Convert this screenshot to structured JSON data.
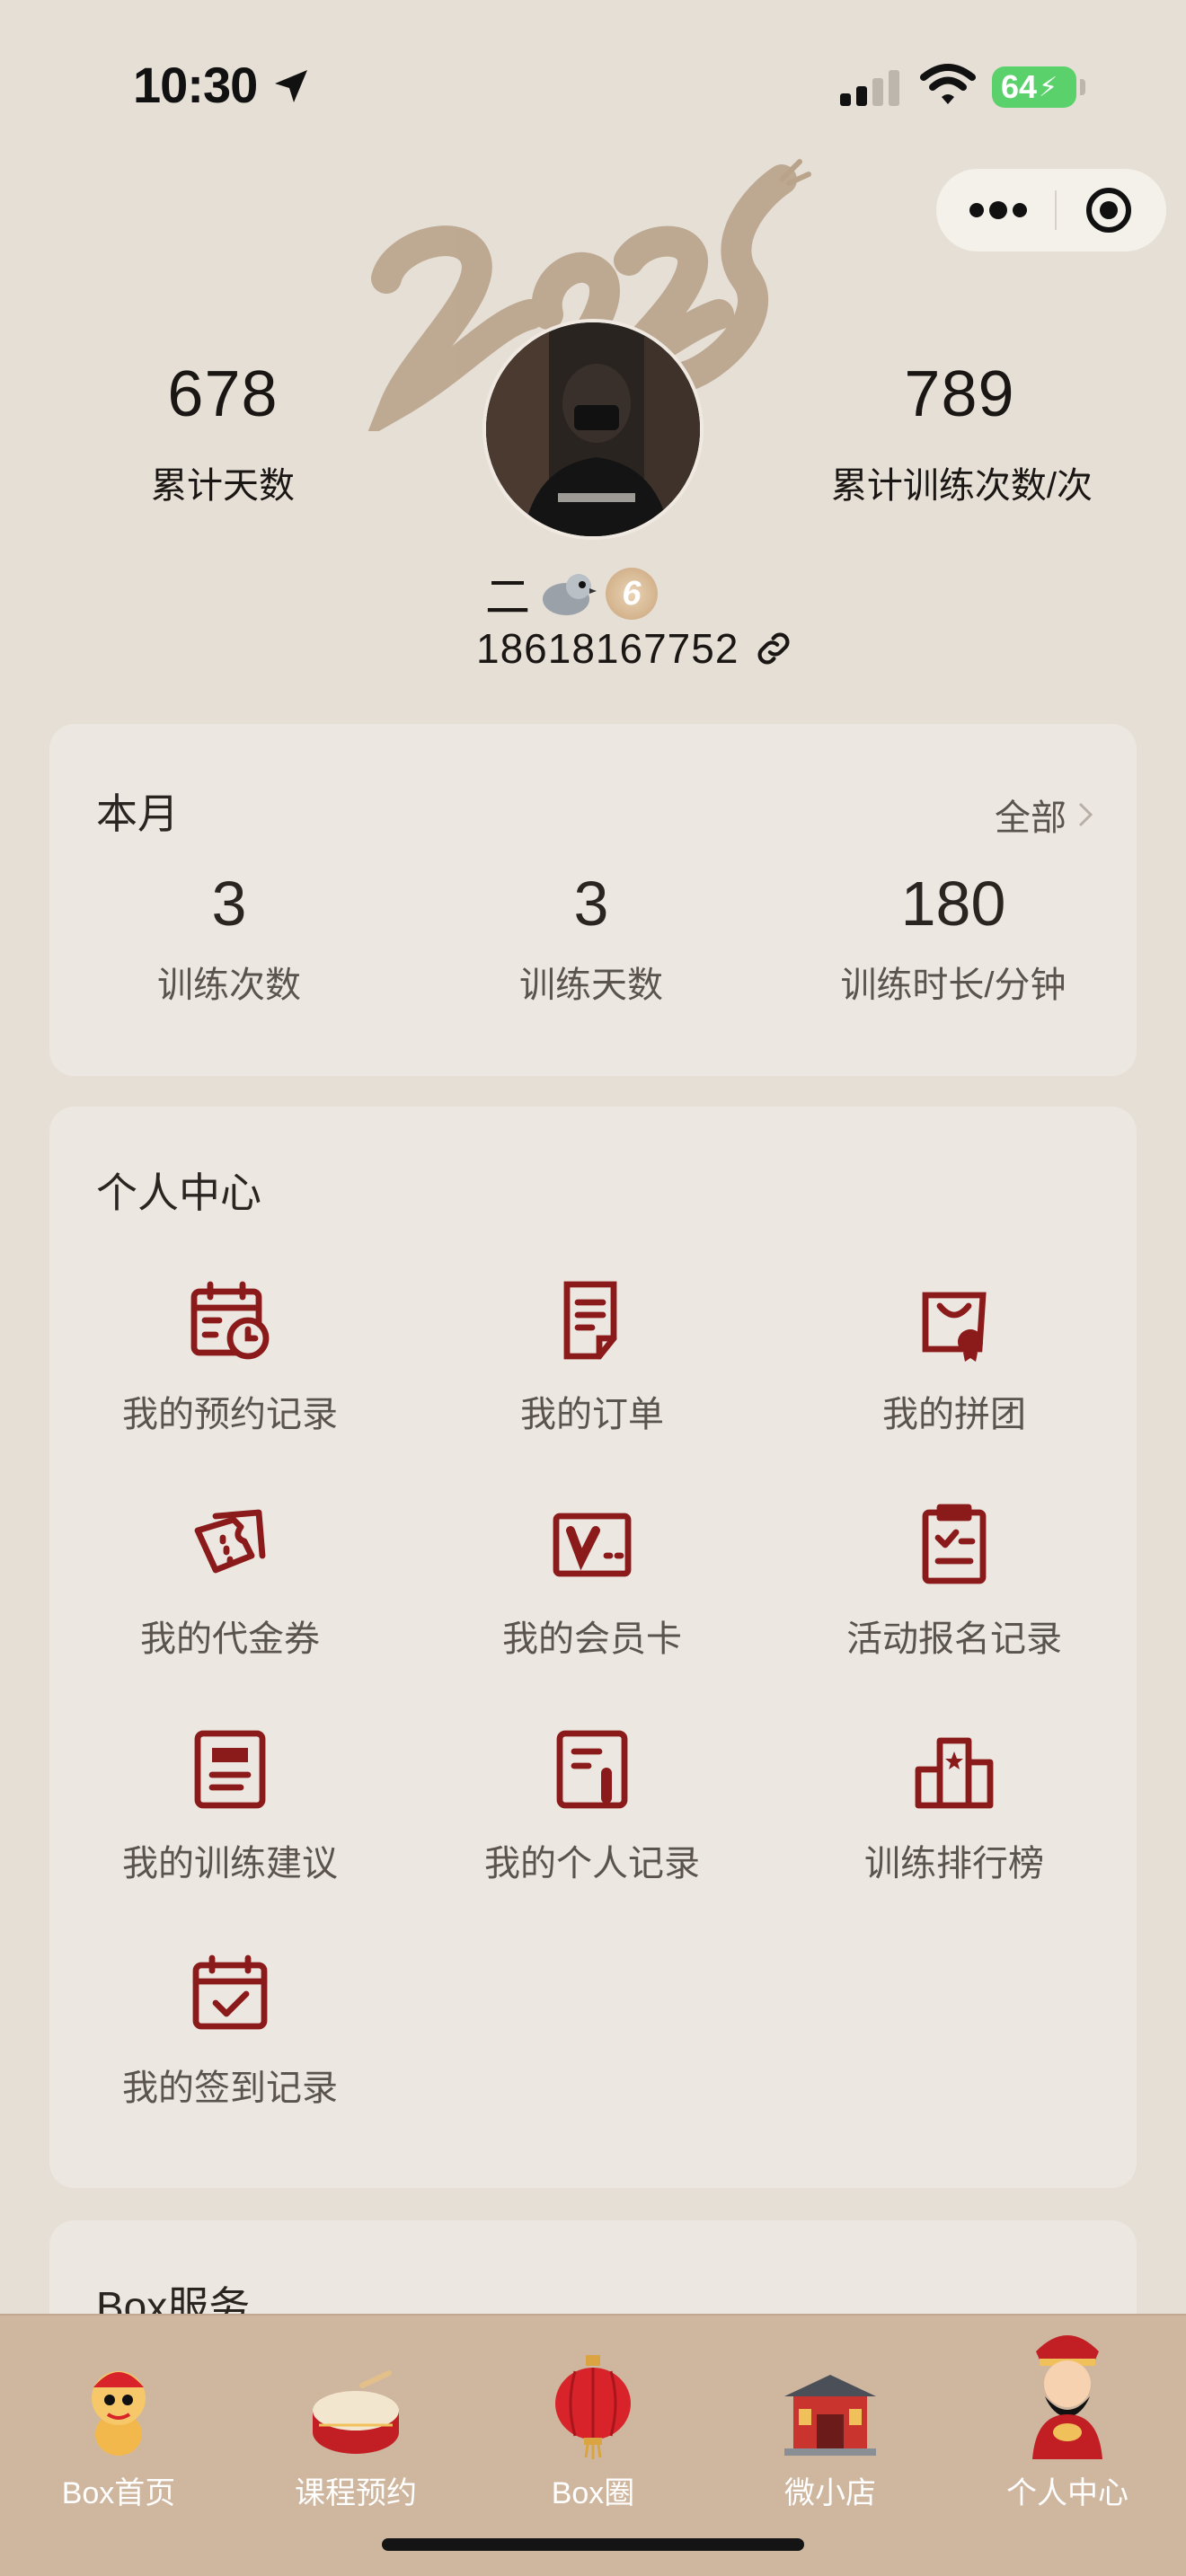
{
  "status_bar": {
    "time": "10:30",
    "battery": "64"
  },
  "capsule": {
    "more_icon": "more-dots-icon",
    "close_icon": "target-icon"
  },
  "profile": {
    "total_days": "678",
    "total_days_label": "累计天数",
    "total_sessions": "789",
    "total_sessions_label": "累计训练次数/次",
    "name": "二",
    "level": "6",
    "phone": "18618167752"
  },
  "this_month": {
    "title": "本月",
    "all_link": "全部",
    "stats": [
      {
        "value": "3",
        "label": "训练次数"
      },
      {
        "value": "3",
        "label": "训练天数"
      },
      {
        "value": "180",
        "label": "训练时长/分钟"
      }
    ]
  },
  "personal_center": {
    "title": "个人中心",
    "items": [
      {
        "label": "我的预约记录",
        "icon": "calendar-clock-icon"
      },
      {
        "label": "我的订单",
        "icon": "document-icon"
      },
      {
        "label": "我的拼团",
        "icon": "shopping-bag-icon"
      },
      {
        "label": "我的代金券",
        "icon": "coupon-icon"
      },
      {
        "label": "我的会员卡",
        "icon": "member-card-icon"
      },
      {
        "label": "活动报名记录",
        "icon": "clipboard-check-icon"
      },
      {
        "label": "我的训练建议",
        "icon": "note-icon"
      },
      {
        "label": "我的个人记录",
        "icon": "record-icon"
      },
      {
        "label": "训练排行榜",
        "icon": "leaderboard-icon"
      },
      {
        "label": "我的签到记录",
        "icon": "calendar-check-icon"
      }
    ]
  },
  "box_service": {
    "title": "Box服务"
  },
  "tabbar": {
    "tabs": [
      {
        "label": "Box首页",
        "icon": "lion-dance-icon"
      },
      {
        "label": "课程预约",
        "icon": "drum-icon"
      },
      {
        "label": "Box圈",
        "icon": "lantern-icon"
      },
      {
        "label": "微小店",
        "icon": "shop-icon"
      },
      {
        "label": "个人中心",
        "icon": "fortune-god-icon",
        "active": true
      }
    ]
  },
  "colors": {
    "accent": "#8b1a1a",
    "background": "#e6dfd6",
    "card": "#ece7e1",
    "tabbar": "#cfb69f"
  }
}
